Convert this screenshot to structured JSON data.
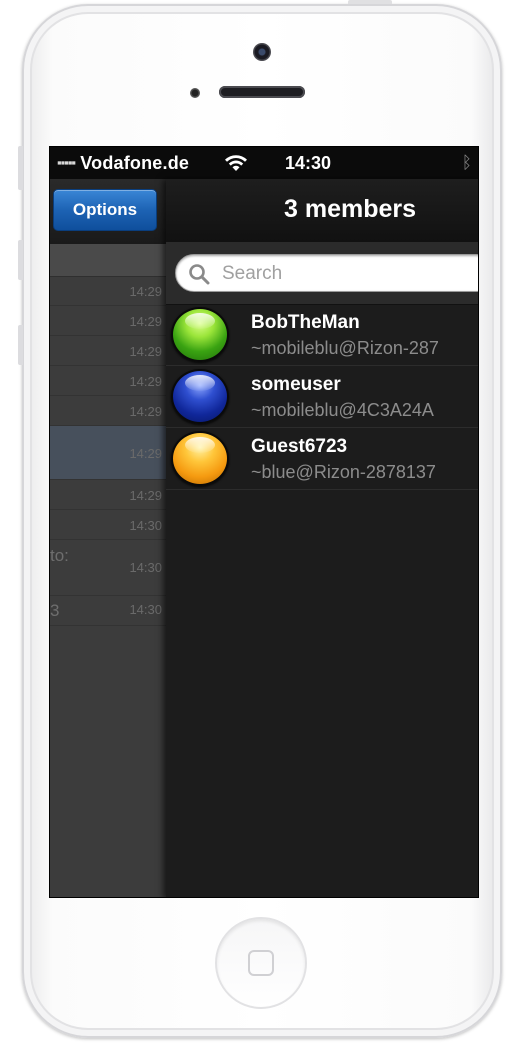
{
  "statusbar": {
    "signal": "▪▪▪▪▪",
    "carrier": "Vodafone.de",
    "time": "14:30",
    "bluetooth_icon": "bluetooth-icon",
    "wifi_icon": "wifi-icon"
  },
  "left_panel": {
    "options_label": "Options",
    "rows": [
      {
        "text": "",
        "time": "14:29"
      },
      {
        "text": "",
        "time": "14:29"
      },
      {
        "text": "",
        "time": "14:29"
      },
      {
        "text": "",
        "time": "14:29"
      },
      {
        "text": "",
        "time": "14:29"
      },
      {
        "text": "",
        "time": "14:29"
      },
      {
        "text": "",
        "time": "14:29"
      },
      {
        "text": "",
        "time": "14:30"
      },
      {
        "text": "to:",
        "time": "14:30"
      },
      {
        "text": "3",
        "time": "14:30"
      }
    ]
  },
  "members": {
    "title": "3 members",
    "search_placeholder": "Search",
    "list": [
      {
        "nick": "BobTheMan",
        "host": "~mobileblu@Rizon-287",
        "status_color": "#3aa312"
      },
      {
        "nick": "someuser",
        "host": "~mobileblu@4C3A24A",
        "status_color": "#10279a"
      },
      {
        "nick": "Guest6723",
        "host": "~blue@Rizon-2878137",
        "status_color": "#f59a10"
      }
    ]
  }
}
